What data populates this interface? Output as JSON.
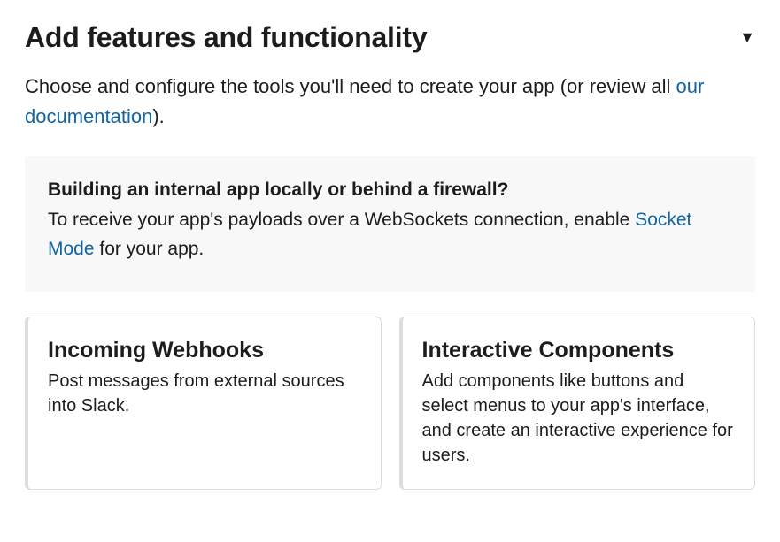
{
  "header": {
    "title": "Add features and functionality"
  },
  "intro": {
    "prefix": "Choose and configure the tools you'll need to create your app (or review all ",
    "link_text": "our documentation",
    "suffix": ")."
  },
  "info": {
    "heading": "Building an internal app locally or behind a firewall?",
    "body_prefix": "To receive your app's payloads over a WebSockets connection, enable ",
    "link_text": "Socket Mode",
    "body_suffix": " for your app."
  },
  "cards": [
    {
      "title": "Incoming Webhooks",
      "desc": "Post messages from external sources into Slack."
    },
    {
      "title": "Interactive Components",
      "desc": "Add components like buttons and select menus to your app's interface, and create an interactive experience for users."
    }
  ]
}
